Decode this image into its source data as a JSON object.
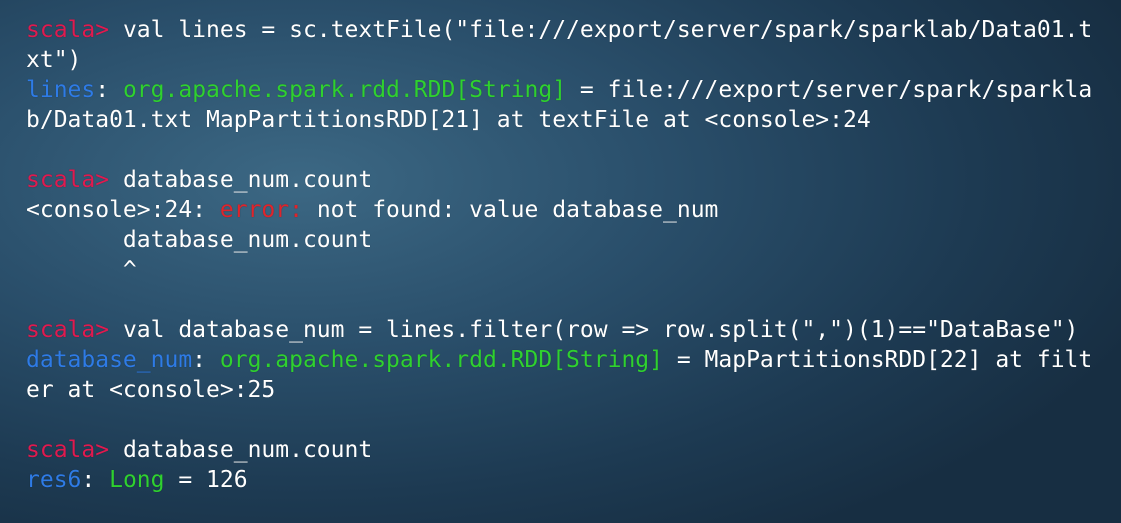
{
  "colors": {
    "prompt": "#e01a4f",
    "identifier": "#2e7be6",
    "type": "#2fd12f",
    "error": "#e0242b",
    "text": "#ffffff"
  },
  "terminal": {
    "lines": [
      {
        "prompt": "scala>",
        "text": " val lines = sc.textFile(\"file:///export/server/spark/sparklab/Data01.t"
      },
      {
        "text": "xt\")"
      },
      {
        "name": "lines",
        "sep": ": ",
        "type": "org.apache.spark.rdd.RDD[String]",
        "text": " = file:///export/server/spark/sparkla"
      },
      {
        "text": "b/Data01.txt MapPartitionsRDD[21] at textFile at <console>:24"
      },
      {
        "text": ""
      },
      {
        "prompt": "scala>",
        "text": " database_num.count"
      },
      {
        "pre": "<console>:24: ",
        "error": "error:",
        "text": " not found: value database_num"
      },
      {
        "text": "       database_num.count"
      },
      {
        "text": "       ^"
      },
      {
        "text": ""
      },
      {
        "prompt": "scala>",
        "text": " val database_num = lines.filter(row => row.split(\",\")(1)==\"DataBase\")"
      },
      {
        "name": "database_num",
        "sep": ": ",
        "type": "org.apache.spark.rdd.RDD[String]",
        "text": " = MapPartitionsRDD[22] at filt"
      },
      {
        "text": "er at <console>:25"
      },
      {
        "text": ""
      },
      {
        "prompt": "scala>",
        "text": " database_num.count"
      },
      {
        "name": "res6",
        "sep": ": ",
        "type": "Long",
        "text": " = 126"
      }
    ]
  }
}
